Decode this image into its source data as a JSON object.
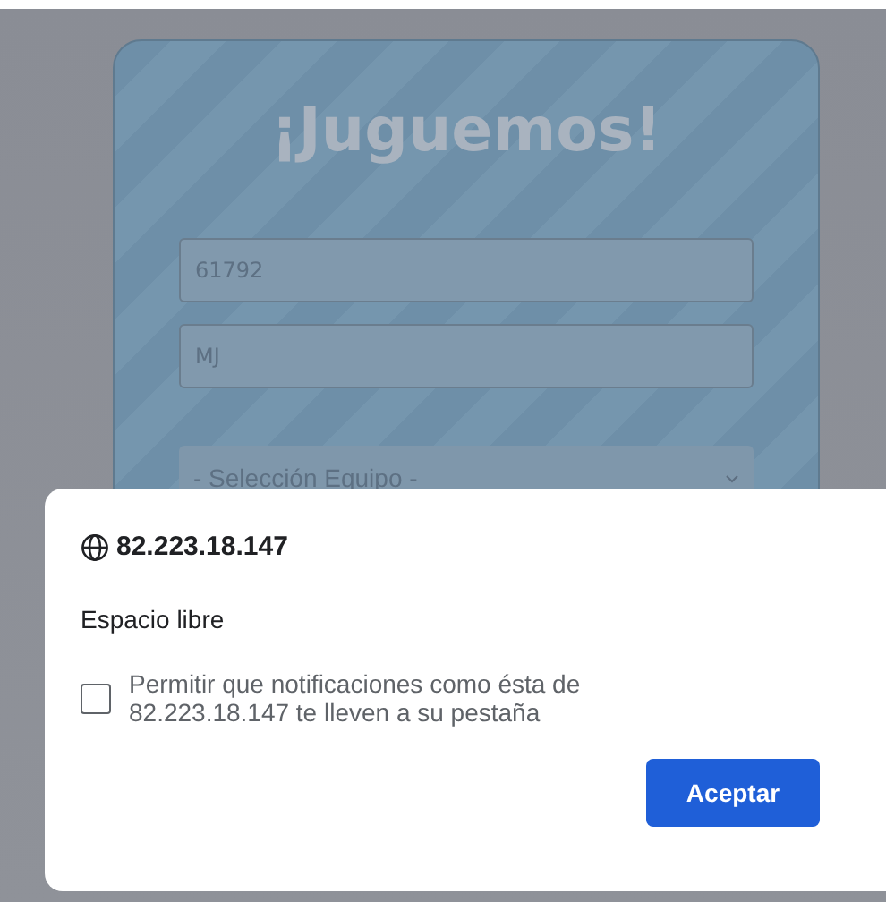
{
  "page": {
    "title": "¡Juguemos!",
    "fields": [
      {
        "value": "61792"
      },
      {
        "value": "MJ"
      }
    ],
    "select": {
      "value": "- Selección Equipo -"
    }
  },
  "dialog": {
    "origin": "82.223.18.147",
    "message": "Espacio libre",
    "checkbox": {
      "label": "Permitir que notificaciones como ésta de 82.223.18.147 te lleven a su pestaña",
      "checked": false
    },
    "button": "Aceptar"
  }
}
